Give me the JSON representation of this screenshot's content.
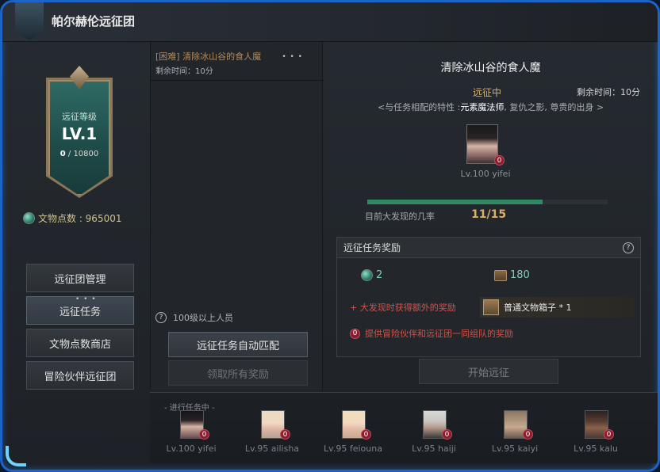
{
  "window": {
    "title": "帕尔赫伦远征团"
  },
  "sidebar": {
    "level_label": "远征等级",
    "level": "LV.1",
    "exp_current": "0",
    "exp_total": "/ 10800",
    "artifact_points_label": "文物点数 : 965001",
    "nav_items": [
      {
        "label": "远征团管理"
      },
      {
        "label": "远征任务"
      },
      {
        "label": "文物点数商店"
      },
      {
        "label": "冒险伙伴远征团"
      }
    ],
    "nav_active_dots": "• • •"
  },
  "quest_list": {
    "items": [
      {
        "name": "[困难] 清除冰山谷的食人魔",
        "time": "剩余时间：10分"
      }
    ],
    "more_dots": "• • •",
    "level_note": "100级以上人员",
    "auto_match_button": "远征任务自动匹配",
    "claim_all_button": "领取所有奖励"
  },
  "detail": {
    "title": "清除冰山谷的食人魔",
    "status": "远征中",
    "remaining": "剩余时间：10分",
    "traits_prefix": "<与任务相配的特性 :",
    "traits_highlight": "元素魔法师",
    "traits_suffix": ", 复仇之影, 尊贵的出身 >",
    "member_name": "Lv.100 yifei",
    "member_count": "0",
    "progress_label": "目前大发现的几率",
    "progress_value": "11/15",
    "progress_fraction": 0.73,
    "rewards": {
      "header": "远征任务奖励",
      "points": "2",
      "exp": "180",
      "bonus_text": "+ 大发现时获得额外的奖励",
      "bonus_item": "普通文物箱子 * 1",
      "bonus_count": "0",
      "party_bonus": "提供冒险伙伴和远征团一同组队的奖励"
    },
    "start_button": "开始远征"
  },
  "ongoing": {
    "label": "- 进行任务中 -",
    "members": [
      {
        "name": "Lv.100 yifei",
        "count": "0"
      },
      {
        "name": "Lv.95 ailisha",
        "count": "0"
      },
      {
        "name": "Lv.95 feiouna",
        "count": "0"
      },
      {
        "name": "Lv.95 haiji",
        "count": "0"
      },
      {
        "name": "Lv.95 kaiyi",
        "count": "0"
      },
      {
        "name": "Lv.95 kalu",
        "count": "0"
      }
    ]
  },
  "colors": {
    "frame_border": "#1c64c8",
    "accent_gold": "#d9b06b",
    "reward_red": "#d0534a",
    "progress_green": "#2f8a62"
  }
}
